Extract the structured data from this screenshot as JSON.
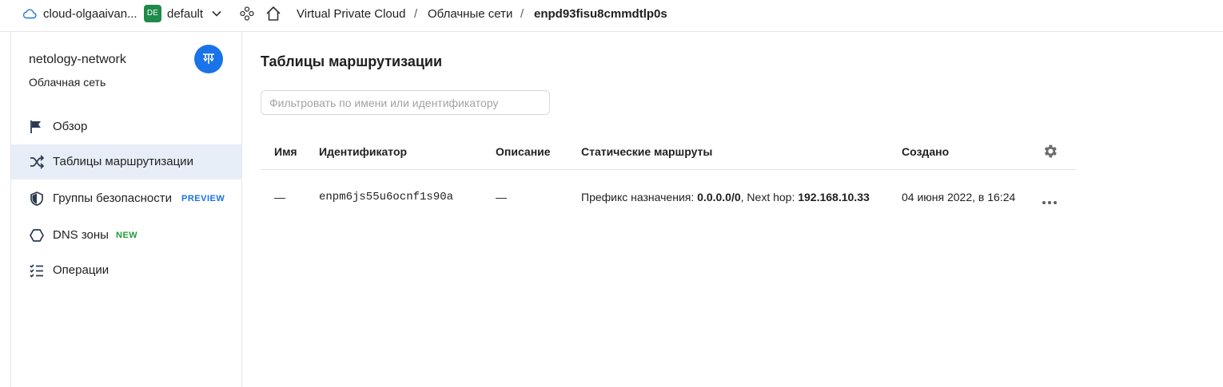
{
  "topbar": {
    "cloud_label": "cloud-olgaaivan...",
    "folder_badge": "DE",
    "folder_label": "default",
    "breadcrumbs": [
      {
        "label": "Virtual Private Cloud"
      },
      {
        "label": "Облачные сети"
      },
      {
        "label": "enpd93fisu8cmmdtlp0s"
      }
    ],
    "separator": "/"
  },
  "sidebar": {
    "title": "netology-network",
    "subtitle": "Облачная сеть",
    "items": [
      {
        "label": "Обзор",
        "icon": "flag-icon"
      },
      {
        "label": "Таблицы маршрутизации",
        "icon": "shuffle-icon",
        "active": true
      },
      {
        "label": "Группы безопасности",
        "icon": "shield-icon",
        "tag": "PREVIEW"
      },
      {
        "label": "DNS зоны",
        "icon": "hexagon-icon",
        "tag": "NEW"
      },
      {
        "label": "Операции",
        "icon": "list-icon"
      }
    ]
  },
  "main": {
    "title": "Таблицы маршрутизации",
    "filter_placeholder": "Фильтровать по имени или идентификатору",
    "columns": {
      "name": "Имя",
      "id": "Идентификатор",
      "description": "Описание",
      "routes": "Статические маршруты",
      "created": "Создано"
    },
    "rows": [
      {
        "name": "—",
        "id": "enpm6js55u6ocnf1s90a",
        "description": "—",
        "routes_prefix_label": "Префикс назначения:",
        "routes_prefix": "0.0.0.0/0",
        "routes_nexthop_label": ", Next hop:",
        "routes_nexthop": "192.168.10.33",
        "created": "04 июня 2022, в 16:24"
      }
    ]
  },
  "colors": {
    "accent": "#1a73e8",
    "active_bg": "#e8eef7",
    "folder_badge": "#1f8a4c",
    "tag_new": "#1f9d3a"
  }
}
